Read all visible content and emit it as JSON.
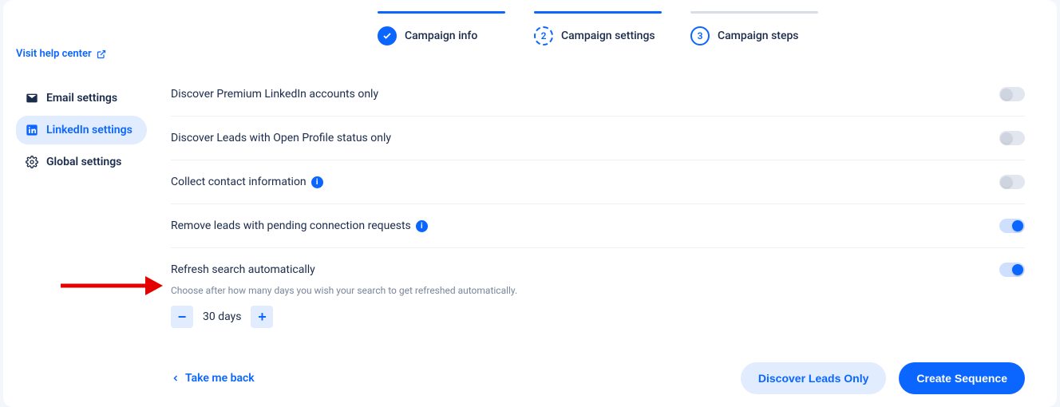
{
  "sidebar": {
    "help_link": "Visit help center",
    "items": [
      {
        "label": "Email settings"
      },
      {
        "label": "LinkedIn settings"
      },
      {
        "label": "Global settings"
      }
    ]
  },
  "stepper": {
    "steps": [
      {
        "label": "Campaign info"
      },
      {
        "label": "Campaign settings",
        "num": "2"
      },
      {
        "label": "Campaign steps",
        "num": "3"
      }
    ]
  },
  "settings": {
    "rows": [
      {
        "label": "Discover Premium LinkedIn accounts only"
      },
      {
        "label": "Discover Leads with Open Profile status only"
      },
      {
        "label": "Collect contact information"
      },
      {
        "label": "Remove leads with pending connection requests"
      },
      {
        "label": "Refresh search automatically"
      }
    ],
    "refresh_help": "Choose after how many days you wish your search to get refreshed automatically.",
    "refresh_value": "30 days"
  },
  "footer": {
    "back": "Take me back",
    "discover": "Discover Leads Only",
    "create": "Create Sequence"
  }
}
